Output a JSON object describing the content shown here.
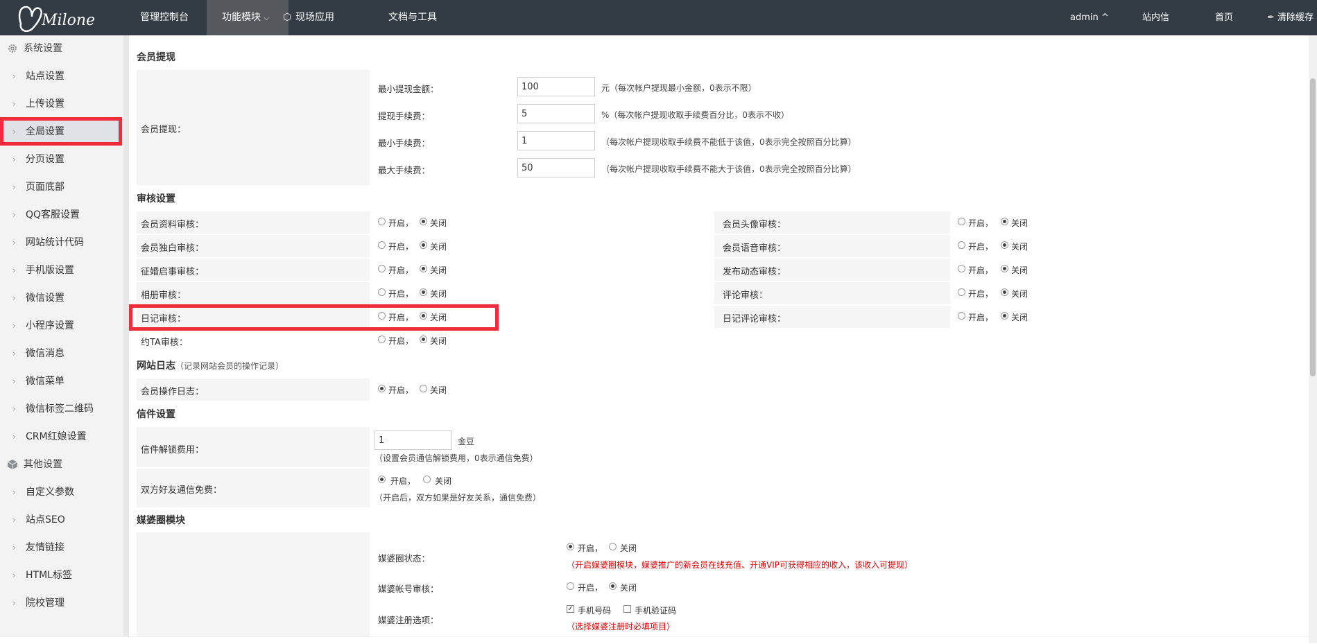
{
  "topbar": {
    "logo_text": "Milone",
    "nav": [
      "管理控制台",
      "功能模块",
      "现场应用",
      "文档与工具"
    ],
    "nav_active": 1,
    "user": "admin ^",
    "links": [
      "站内信",
      "首页",
      "清除缓存"
    ]
  },
  "sidebar": {
    "cat1": "系统设置",
    "items1": [
      "站点设置",
      "上传设置",
      "全局设置",
      "分页设置",
      "页面底部",
      "QQ客服设置",
      "网站统计代码",
      "手机版设置",
      "微信设置",
      "小程序设置",
      "微信消息",
      "微信菜单",
      "微信标签二维码",
      "CRM红娘设置"
    ],
    "cat2": "其他设置",
    "items2": [
      "自定义参数",
      "站点SEO",
      "友情链接",
      "HTML标签",
      "院校管理"
    ],
    "active_item": "全局设置"
  },
  "withdraw": {
    "title": "会员提现",
    "group_label": "会员提现：",
    "fields": [
      {
        "label": "最小提现金额：",
        "value": "100",
        "hint": "元（每次帐户提现最小金额，0表示不限）"
      },
      {
        "label": "提现手续费：",
        "value": "5",
        "hint": "%（每次帐户提现收取手续费百分比，0表示不收）"
      },
      {
        "label": "最小手续费：",
        "value": "1",
        "hint": "（每次帐户提现收取手续费不能低于该值，0表示完全按照百分比算）"
      },
      {
        "label": "最大手续费：",
        "value": "50",
        "hint": "（每次帐户提现收取手续费不能大于该值，0表示完全按照百分比算）"
      }
    ]
  },
  "audit": {
    "title": "审核设置",
    "on": "开启，",
    "off": "关闭",
    "left": [
      "会员资料审核：",
      "会员独白审核：",
      "征婚启事审核：",
      "相册审核：",
      "日记审核：",
      "约TA审核："
    ],
    "right": [
      "会员头像审核：",
      "会员语音审核：",
      "发布动态审核：",
      "评论审核：",
      "日记评论审核："
    ]
  },
  "log": {
    "title": "网站日志",
    "note": "（记录网站会员的操作记录）",
    "label": "会员操作日志：",
    "on": "开启，",
    "off": "关闭"
  },
  "letter": {
    "title": "信件设置",
    "unlock_label": "信件解锁费用：",
    "unlock_value": "1",
    "unlock_unit": "金豆",
    "unlock_hint": "（设置会员通信解锁费用，0表示通信免费）",
    "free_label": "双方好友通信免费：",
    "on": "开启，",
    "off": "关闭",
    "free_hint": "（开启后，双方如果是好友关系，通信免费）"
  },
  "mpq": {
    "title": "媒婆圈模块",
    "status_label": "媒婆圈状态：",
    "on": "开启，",
    "off": "关闭",
    "status_hint": "（开启媒婆圈模块，媒婆推广的新会员在线充值、开通VIP可获得相应的收入，该收入可提现）",
    "audit_label": "媒婆帐号审核：",
    "reg_label": "媒婆注册选项：",
    "opt_phone": "手机号码",
    "opt_code": "手机验证码",
    "reg_hint": "（选择媒婆注册时必填项目）"
  }
}
